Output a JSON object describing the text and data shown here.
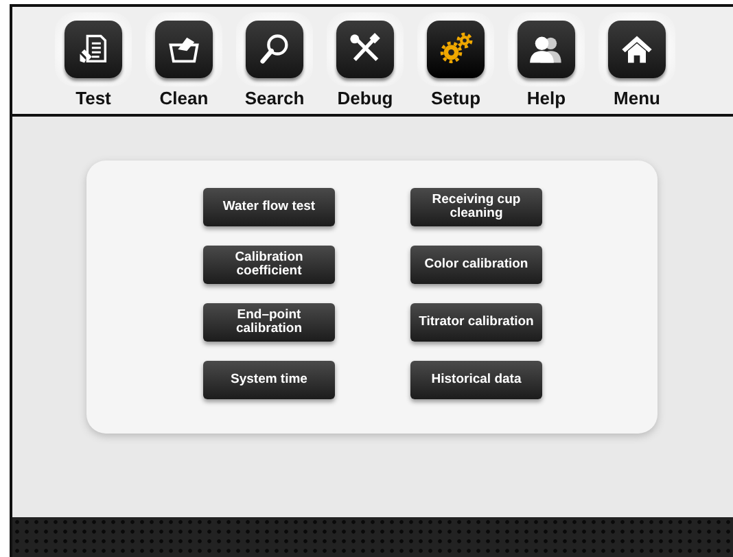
{
  "toolbar": {
    "items": [
      {
        "label": "Test",
        "kind": "document",
        "selected": false
      },
      {
        "label": "Clean",
        "kind": "basin",
        "selected": false
      },
      {
        "label": "Search",
        "kind": "magnifier",
        "selected": false
      },
      {
        "label": "Debug",
        "kind": "tools",
        "selected": false
      },
      {
        "label": "Setup",
        "kind": "gears",
        "selected": true
      },
      {
        "label": "Help",
        "kind": "people",
        "selected": false
      },
      {
        "label": "Menu",
        "kind": "house",
        "selected": false
      }
    ]
  },
  "settings": {
    "buttons": [
      {
        "label": "Water flow test"
      },
      {
        "label": "Receiving cup cleaning"
      },
      {
        "label": "Calibration coefficient"
      },
      {
        "label": "Color calibration"
      },
      {
        "label": "End–point calibration"
      },
      {
        "label": "Titrator calibration"
      },
      {
        "label": "System time"
      },
      {
        "label": "Historical data"
      }
    ]
  }
}
